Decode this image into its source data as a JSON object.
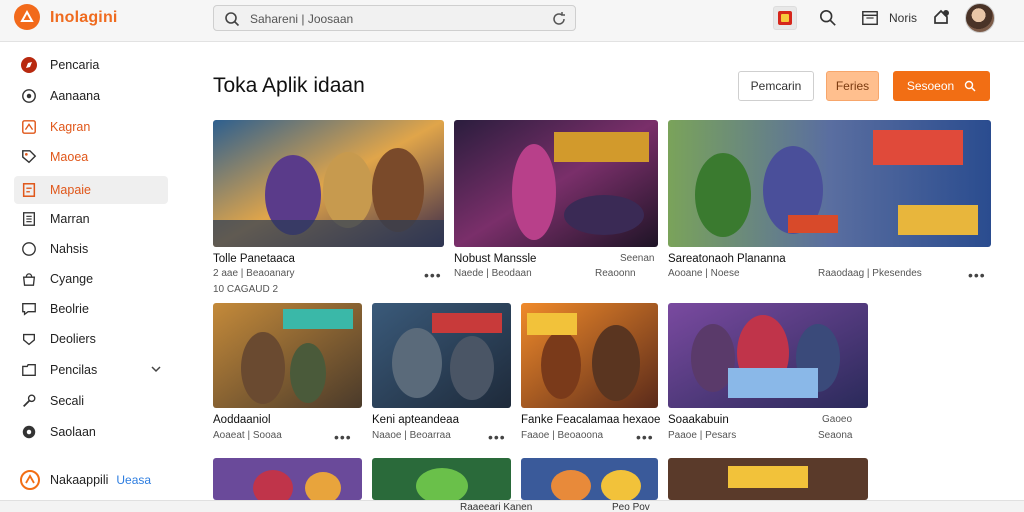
{
  "app": {
    "name": "Inolagini"
  },
  "search": {
    "placeholder": "Sahareni | Joosaan"
  },
  "topbar": {
    "user_text": "Noris"
  },
  "sidebar": {
    "items": [
      {
        "label": "Pencaria",
        "icon": "compass-icon",
        "style": "normal"
      },
      {
        "label": "Aanaana",
        "icon": "circle-icon",
        "style": "normal"
      },
      {
        "label": "Kagran",
        "icon": "grid-icon",
        "style": "orange"
      },
      {
        "label": "Maoea",
        "icon": "tag-icon",
        "style": "orange"
      },
      {
        "label": "Mapaie",
        "icon": "document-icon",
        "style": "active"
      },
      {
        "label": "Marran",
        "icon": "list-icon",
        "style": "normal"
      },
      {
        "label": "Nahsis",
        "icon": "circle-outline-icon",
        "style": "normal"
      },
      {
        "label": "Cyange",
        "icon": "bag-icon",
        "style": "normal"
      },
      {
        "label": "Beolrie",
        "icon": "chat-icon",
        "style": "normal"
      },
      {
        "label": "Deoliers",
        "icon": "shield-icon",
        "style": "normal"
      },
      {
        "label": "Pencilas",
        "icon": "folder-icon",
        "style": "normal",
        "expandable": true
      },
      {
        "label": "Secali",
        "icon": "wrench-icon",
        "style": "normal"
      },
      {
        "label": "Saolaan",
        "icon": "gear-icon",
        "style": "normal"
      }
    ],
    "promo": {
      "label": "Nakaappili",
      "link": "Ueasa"
    }
  },
  "main": {
    "title": "Toka Aplik idaan",
    "buttons": {
      "outline": "Pemcarin",
      "soft": "Feries",
      "primary": "Sesoeon"
    }
  },
  "cards_row1": [
    {
      "title": "Tolle Panetaaca",
      "sub1": "2 aae | Beaoanary",
      "sub2": "10 CAGAUD 2"
    },
    {
      "title": "Nobust Manssle",
      "sub1": "Naede | Beodaan",
      "right": "Seenan",
      "right2": "Reaoonn"
    },
    {
      "title": "Sareatonaoh Plananna",
      "sub1": "Aooane | Noese",
      "right2": "Raaodaag | Pkesendes"
    }
  ],
  "cards_row2": [
    {
      "title": "Aoddaaniol",
      "sub1": "Aoaeat | Sooaa"
    },
    {
      "title": "Keni apteandeaa",
      "sub1": "Naaoe | Beoarraa"
    },
    {
      "title": "Fanke Feacalamaa hexaoe",
      "sub1": "Faaoe | Beoaoona"
    },
    {
      "title": "Soaakabuin",
      "sub1": "Paaoe | Pesars",
      "right": "Gaoeo",
      "right2": "Seaona"
    }
  ],
  "footer": {
    "left": "Raaeeari Kanen",
    "right": "Peo Pov"
  },
  "colors": {
    "accent": "#f26e14",
    "active_bg": "#efefef",
    "link": "#2d7de0"
  }
}
